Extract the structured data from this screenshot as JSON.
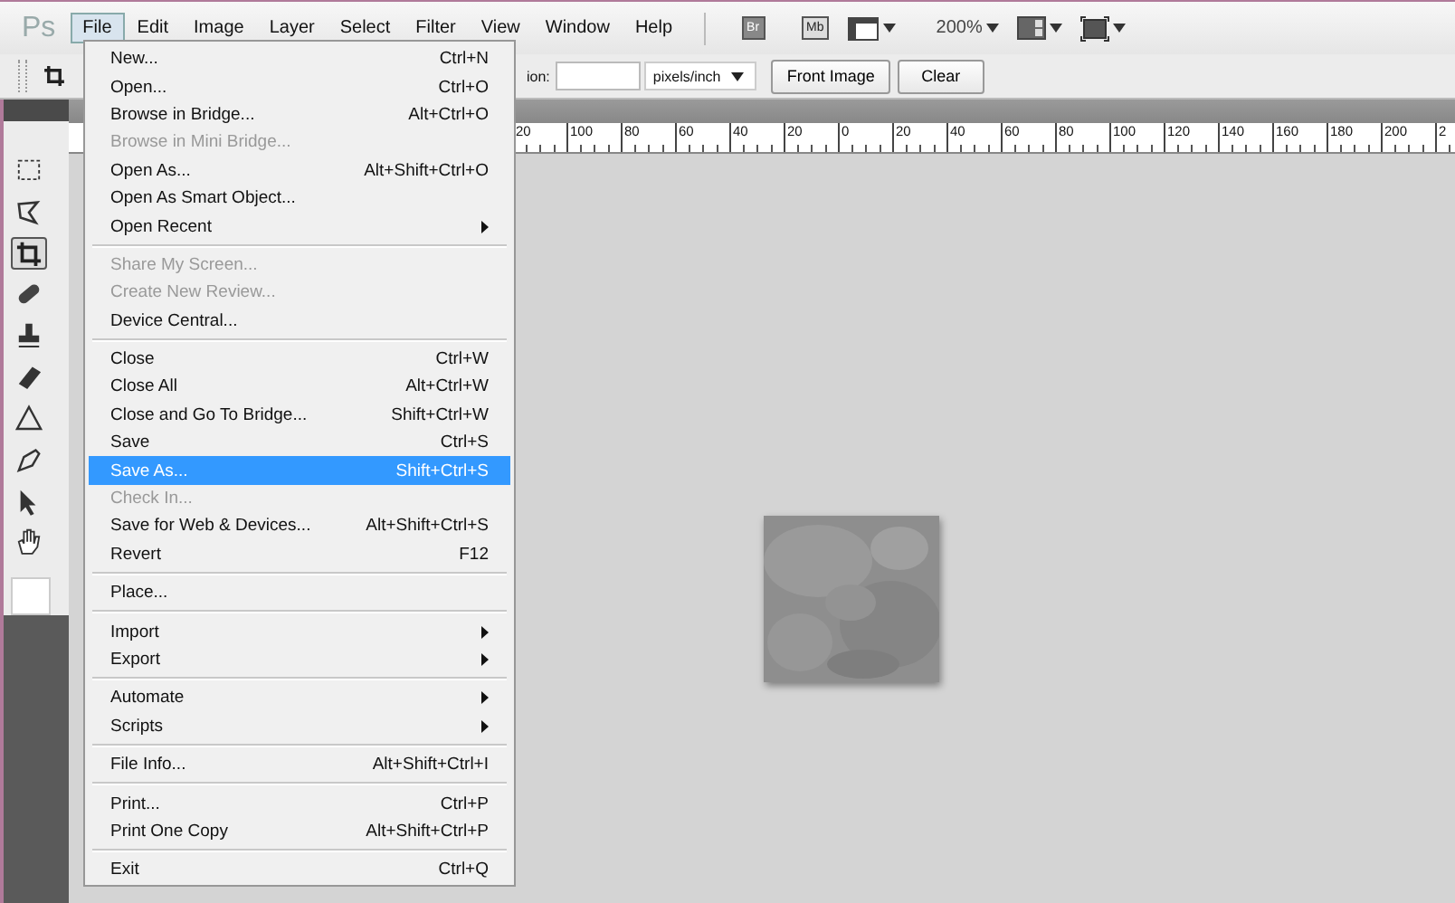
{
  "menu_bar": {
    "logo": "Ps",
    "items": [
      {
        "label": "File",
        "selected": true
      },
      {
        "label": "Edit",
        "selected": false
      },
      {
        "label": "Image",
        "selected": false
      },
      {
        "label": "Layer",
        "selected": false
      },
      {
        "label": "Select",
        "selected": false
      },
      {
        "label": "Filter",
        "selected": false
      },
      {
        "label": "View",
        "selected": false
      },
      {
        "label": "Window",
        "selected": false
      },
      {
        "label": "Help",
        "selected": false
      }
    ],
    "bridge_button": "Br",
    "mini_bridge_button": "Mb",
    "zoom": "200%"
  },
  "options_bar": {
    "label": "ion:",
    "unit": "pixels/inch",
    "buttons": [
      "Front Image",
      "Clear"
    ]
  },
  "ruler": [
    "20",
    "100",
    "80",
    "60",
    "40",
    "20",
    "0",
    "20",
    "40",
    "60",
    "80",
    "100",
    "120",
    "140",
    "160",
    "180",
    "200",
    "2"
  ],
  "file_menu": [
    {
      "kind": "item",
      "label": "New...",
      "shortcut": "Ctrl+N",
      "disabled": false,
      "selected": false
    },
    {
      "kind": "item",
      "label": "Open...",
      "shortcut": "Ctrl+O",
      "disabled": false,
      "selected": false
    },
    {
      "kind": "item",
      "label": "Browse in Bridge...",
      "shortcut": "Alt+Ctrl+O",
      "disabled": false,
      "selected": false
    },
    {
      "kind": "item",
      "label": "Browse in Mini Bridge...",
      "disabled": true,
      "selected": false
    },
    {
      "kind": "item",
      "label": "Open As...",
      "shortcut": "Alt+Shift+Ctrl+O",
      "disabled": false,
      "selected": false
    },
    {
      "kind": "item",
      "label": "Open As Smart Object...",
      "disabled": false,
      "selected": false
    },
    {
      "kind": "submenu",
      "label": "Open Recent",
      "disabled": false,
      "selected": false
    },
    {
      "kind": "separator"
    },
    {
      "kind": "item",
      "label": "Share My Screen...",
      "disabled": true,
      "selected": false
    },
    {
      "kind": "item",
      "label": "Create New Review...",
      "disabled": true,
      "selected": false
    },
    {
      "kind": "item",
      "label": "Device Central...",
      "disabled": false,
      "selected": false
    },
    {
      "kind": "separator"
    },
    {
      "kind": "item",
      "label": "Close",
      "shortcut": "Ctrl+W",
      "disabled": false,
      "selected": false
    },
    {
      "kind": "item",
      "label": "Close All",
      "shortcut": "Alt+Ctrl+W",
      "disabled": false,
      "selected": false
    },
    {
      "kind": "item",
      "label": "Close and Go To Bridge...",
      "shortcut": "Shift+Ctrl+W",
      "disabled": false,
      "selected": false
    },
    {
      "kind": "item",
      "label": "Save",
      "shortcut": "Ctrl+S",
      "disabled": false,
      "selected": false
    },
    {
      "kind": "item",
      "label": "Save As...",
      "shortcut": "Shift+Ctrl+S",
      "disabled": false,
      "selected": true
    },
    {
      "kind": "item",
      "label": "Check In...",
      "disabled": true,
      "selected": false
    },
    {
      "kind": "item",
      "label": "Save for Web & Devices...",
      "shortcut": "Alt+Shift+Ctrl+S",
      "disabled": false,
      "selected": false
    },
    {
      "kind": "item",
      "label": "Revert",
      "shortcut": "F12",
      "disabled": false,
      "selected": false
    },
    {
      "kind": "separator"
    },
    {
      "kind": "item",
      "label": "Place...",
      "disabled": false,
      "selected": false
    },
    {
      "kind": "separator"
    },
    {
      "kind": "submenu",
      "label": "Import",
      "disabled": false,
      "selected": false
    },
    {
      "kind": "submenu",
      "label": "Export",
      "disabled": false,
      "selected": false
    },
    {
      "kind": "separator"
    },
    {
      "kind": "submenu",
      "label": "Automate",
      "disabled": false,
      "selected": false
    },
    {
      "kind": "submenu",
      "label": "Scripts",
      "disabled": false,
      "selected": false
    },
    {
      "kind": "separator"
    },
    {
      "kind": "item",
      "label": "File Info...",
      "shortcut": "Alt+Shift+Ctrl+I",
      "disabled": false,
      "selected": false
    },
    {
      "kind": "separator"
    },
    {
      "kind": "item",
      "label": "Print...",
      "shortcut": "Ctrl+P",
      "disabled": false,
      "selected": false
    },
    {
      "kind": "item",
      "label": "Print One Copy",
      "shortcut": "Alt+Shift+Ctrl+P",
      "disabled": false,
      "selected": false
    },
    {
      "kind": "separator"
    },
    {
      "kind": "item",
      "label": "Exit",
      "shortcut": "Ctrl+Q",
      "disabled": false,
      "selected": false
    }
  ]
}
